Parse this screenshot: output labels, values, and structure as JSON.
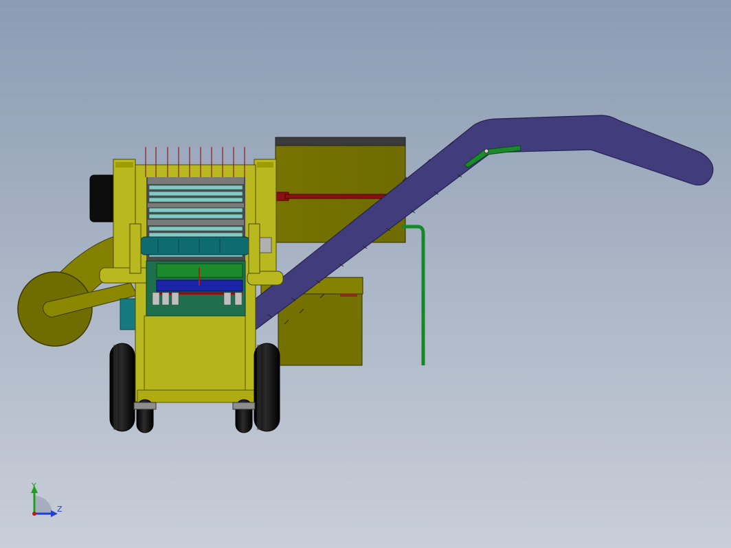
{
  "viewport": {
    "background_top": "#8b9cb3",
    "background_bottom": "#c9ced8"
  },
  "triad": {
    "y_label": "Y",
    "z_label": "Z",
    "y_color": "#1aa31a",
    "z_color": "#1f3fd1",
    "origin_color": "#c01818"
  },
  "colors": {
    "body_yellow": "#b9b81e",
    "body_yellow_dark": "#747100",
    "chute_blue": "#413d7c",
    "tire_black": "#0a0a0a",
    "teal": "#0e6b70",
    "cyan_slats": "#84c9c3",
    "rod_red": "#8a1111",
    "pipe_green": "#138a26",
    "panel_green": "#1a8a2c",
    "panel_blue": "#1c24a8"
  },
  "icons": {
    "triad": "coordinate-triad-icon"
  }
}
